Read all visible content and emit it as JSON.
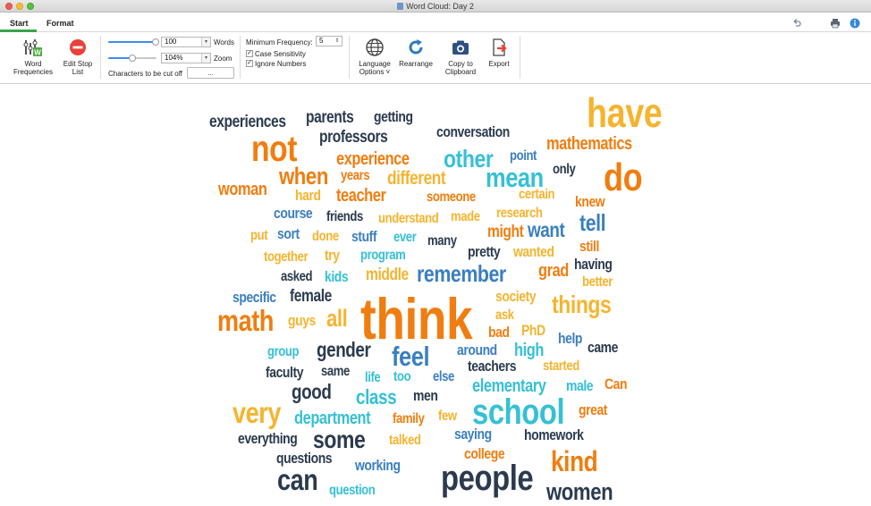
{
  "window": {
    "title": "Word Cloud: Day 2"
  },
  "tabs": [
    {
      "label": "Start"
    },
    {
      "label": "Format"
    }
  ],
  "ribbon": {
    "word_frequencies": "Word Frequencies",
    "edit_stop_list": "Edit Stop List",
    "words_value": "100",
    "words_label": "Words",
    "zoom_value": "104%",
    "zoom_label": "Zoom",
    "cutoff_label": "Characters to be cut off",
    "cutoff_button": "...",
    "min_freq_label": "Minimum Frequency:",
    "min_freq_value": "5",
    "case_sensitivity": "Case Sensitivity",
    "ignore_numbers": "Ignore Numbers",
    "language_options": "Language Options",
    "rearrange": "Rearrange",
    "copy_clipboard": "Copy to Clipboard",
    "export": "Export"
  },
  "colors": {
    "dark": "#2b3a4e",
    "orange": "#f07d0f",
    "gold": "#f5b42f",
    "teal": "#35c0d5",
    "blue": "#3a7fc0"
  },
  "cloud": [
    {
      "t": "experiences",
      "c": "dark"
    },
    {
      "t": "parents",
      "c": "dark"
    },
    {
      "t": "getting",
      "c": "dark"
    },
    {
      "t": "have",
      "c": "gold"
    },
    {
      "t": "not",
      "c": "orange"
    },
    {
      "t": "professors",
      "c": "dark"
    },
    {
      "t": "conversation",
      "c": "dark"
    },
    {
      "t": "mathematics",
      "c": "orange"
    },
    {
      "t": "other",
      "c": "teal"
    },
    {
      "t": "experience",
      "c": "orange"
    },
    {
      "t": "point",
      "c": "blue"
    },
    {
      "t": "only",
      "c": "dark"
    },
    {
      "t": "when",
      "c": "orange"
    },
    {
      "t": "years",
      "c": "orange"
    },
    {
      "t": "different",
      "c": "gold"
    },
    {
      "t": "mean",
      "c": "teal"
    },
    {
      "t": "do",
      "c": "orange"
    },
    {
      "t": "woman",
      "c": "orange"
    },
    {
      "t": "hard",
      "c": "gold"
    },
    {
      "t": "teacher",
      "c": "orange"
    },
    {
      "t": "someone",
      "c": "orange"
    },
    {
      "t": "certain",
      "c": "gold"
    },
    {
      "t": "knew",
      "c": "orange"
    },
    {
      "t": "course",
      "c": "blue"
    },
    {
      "t": "friends",
      "c": "dark"
    },
    {
      "t": "understand",
      "c": "gold"
    },
    {
      "t": "made",
      "c": "gold"
    },
    {
      "t": "research",
      "c": "gold"
    },
    {
      "t": "tell",
      "c": "blue"
    },
    {
      "t": "put",
      "c": "gold"
    },
    {
      "t": "sort",
      "c": "blue"
    },
    {
      "t": "done",
      "c": "gold"
    },
    {
      "t": "stuff",
      "c": "blue"
    },
    {
      "t": "ever",
      "c": "teal"
    },
    {
      "t": "many",
      "c": "dark"
    },
    {
      "t": "might",
      "c": "orange"
    },
    {
      "t": "want",
      "c": "blue"
    },
    {
      "t": "still",
      "c": "orange"
    },
    {
      "t": "together",
      "c": "gold"
    },
    {
      "t": "try",
      "c": "gold"
    },
    {
      "t": "program",
      "c": "teal"
    },
    {
      "t": "pretty",
      "c": "dark"
    },
    {
      "t": "wanted",
      "c": "gold"
    },
    {
      "t": "having",
      "c": "dark"
    },
    {
      "t": "asked",
      "c": "dark"
    },
    {
      "t": "kids",
      "c": "teal"
    },
    {
      "t": "middle",
      "c": "gold"
    },
    {
      "t": "remember",
      "c": "blue"
    },
    {
      "t": "grad",
      "c": "orange"
    },
    {
      "t": "better",
      "c": "gold"
    },
    {
      "t": "specific",
      "c": "blue"
    },
    {
      "t": "female",
      "c": "dark"
    },
    {
      "t": "society",
      "c": "gold"
    },
    {
      "t": "math",
      "c": "orange"
    },
    {
      "t": "guys",
      "c": "gold"
    },
    {
      "t": "all",
      "c": "gold"
    },
    {
      "t": "think",
      "c": "orange"
    },
    {
      "t": "ask",
      "c": "gold"
    },
    {
      "t": "things",
      "c": "gold"
    },
    {
      "t": "bad",
      "c": "orange"
    },
    {
      "t": "PhD",
      "c": "gold"
    },
    {
      "t": "help",
      "c": "blue"
    },
    {
      "t": "group",
      "c": "teal"
    },
    {
      "t": "gender",
      "c": "dark"
    },
    {
      "t": "feel",
      "c": "blue"
    },
    {
      "t": "around",
      "c": "blue"
    },
    {
      "t": "high",
      "c": "teal"
    },
    {
      "t": "came",
      "c": "dark"
    },
    {
      "t": "faculty",
      "c": "dark"
    },
    {
      "t": "same",
      "c": "dark"
    },
    {
      "t": "life",
      "c": "teal"
    },
    {
      "t": "too",
      "c": "teal"
    },
    {
      "t": "else",
      "c": "blue"
    },
    {
      "t": "teachers",
      "c": "dark"
    },
    {
      "t": "started",
      "c": "gold"
    },
    {
      "t": "good",
      "c": "dark"
    },
    {
      "t": "class",
      "c": "teal"
    },
    {
      "t": "men",
      "c": "dark"
    },
    {
      "t": "elementary",
      "c": "teal"
    },
    {
      "t": "male",
      "c": "teal"
    },
    {
      "t": "Can",
      "c": "orange"
    },
    {
      "t": "very",
      "c": "gold"
    },
    {
      "t": "department",
      "c": "teal"
    },
    {
      "t": "family",
      "c": "orange"
    },
    {
      "t": "few",
      "c": "gold"
    },
    {
      "t": "school",
      "c": "teal"
    },
    {
      "t": "great",
      "c": "orange"
    },
    {
      "t": "everything",
      "c": "dark"
    },
    {
      "t": "some",
      "c": "dark"
    },
    {
      "t": "talked",
      "c": "gold"
    },
    {
      "t": "saying",
      "c": "blue"
    },
    {
      "t": "homework",
      "c": "dark"
    },
    {
      "t": "questions",
      "c": "dark"
    },
    {
      "t": "working",
      "c": "blue"
    },
    {
      "t": "college",
      "c": "orange"
    },
    {
      "t": "kind",
      "c": "orange"
    },
    {
      "t": "can",
      "c": "dark"
    },
    {
      "t": "question",
      "c": "teal"
    },
    {
      "t": "people",
      "c": "dark"
    },
    {
      "t": "women",
      "c": "dark"
    }
  ]
}
